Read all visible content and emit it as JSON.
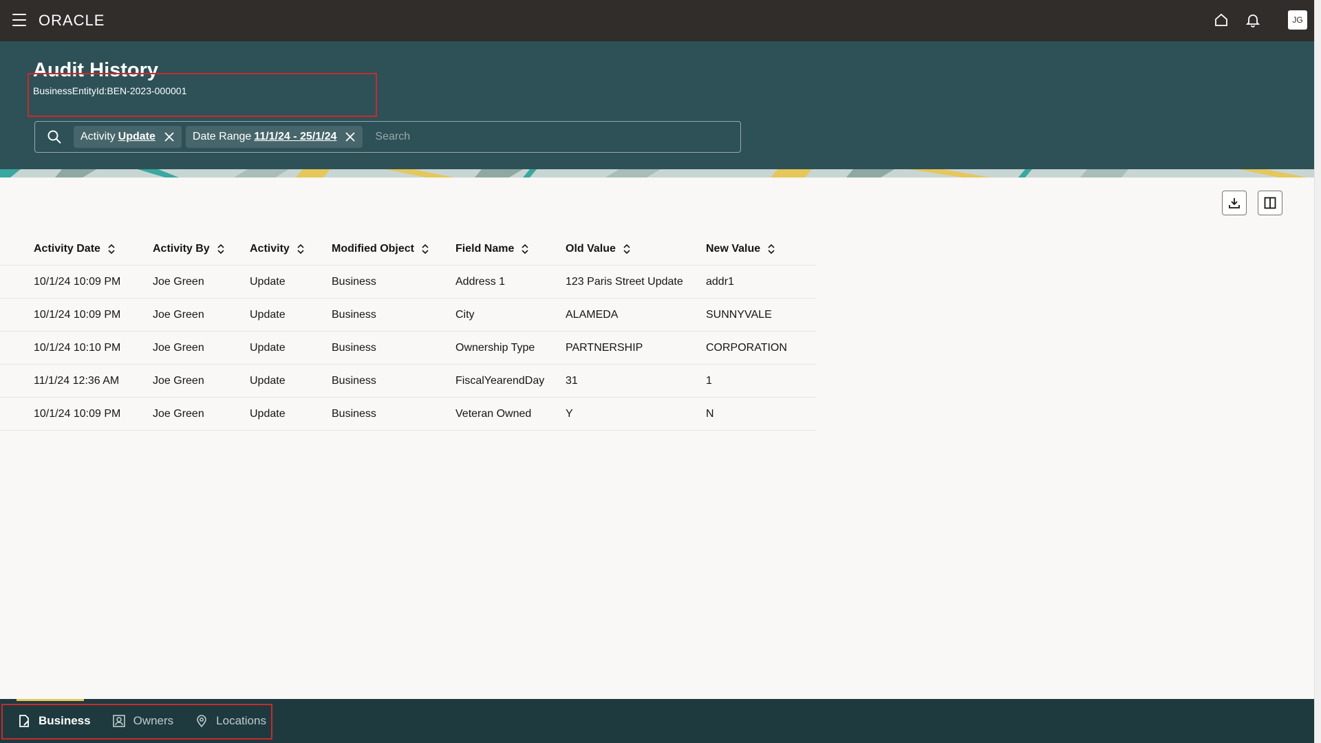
{
  "app": {
    "logo": "ORACLE",
    "user_initials": "JG"
  },
  "header": {
    "title": "Audit History",
    "subtitle": "BusinessEntityId:BEN-2023-000001"
  },
  "search": {
    "placeholder": "Search",
    "filters": [
      {
        "label": "Activity",
        "value": "Update"
      },
      {
        "label": "Date Range",
        "value": "11/1/24 - 25/1/24"
      }
    ]
  },
  "table": {
    "columns": [
      "Activity Date",
      "Activity By",
      "Activity",
      "Modified Object",
      "Field Name",
      "Old Value",
      "New Value"
    ],
    "rows": [
      [
        "10/1/24 10:09 PM",
        "Joe Green",
        "Update",
        "Business",
        "Address 1",
        "123 Paris Street Update",
        "addr1"
      ],
      [
        "10/1/24 10:09 PM",
        "Joe Green",
        "Update",
        "Business",
        "City",
        "ALAMEDA",
        "SUNNYVALE"
      ],
      [
        "10/1/24 10:10 PM",
        "Joe Green",
        "Update",
        "Business",
        "Ownership Type",
        "PARTNERSHIP",
        "CORPORATION"
      ],
      [
        "11/1/24 12:36 AM",
        "Joe Green",
        "Update",
        "Business",
        "FiscalYearendDay",
        "31",
        "1"
      ],
      [
        "10/1/24 10:09 PM",
        "Joe Green",
        "Update",
        "Business",
        "Veteran Owned",
        "Y",
        "N"
      ]
    ]
  },
  "bottom_nav": {
    "items": [
      {
        "label": "Business",
        "icon": "document-edit-icon",
        "active": true
      },
      {
        "label": "Owners",
        "icon": "person-badge-icon",
        "active": false
      },
      {
        "label": "Locations",
        "icon": "map-pin-icon",
        "active": false
      }
    ]
  },
  "colors": {
    "topbar": "#312d2a",
    "header": "#2d5157",
    "bottombar": "#1e3a3f",
    "highlight": "#c92b2b",
    "accent": "#e5c75b"
  }
}
